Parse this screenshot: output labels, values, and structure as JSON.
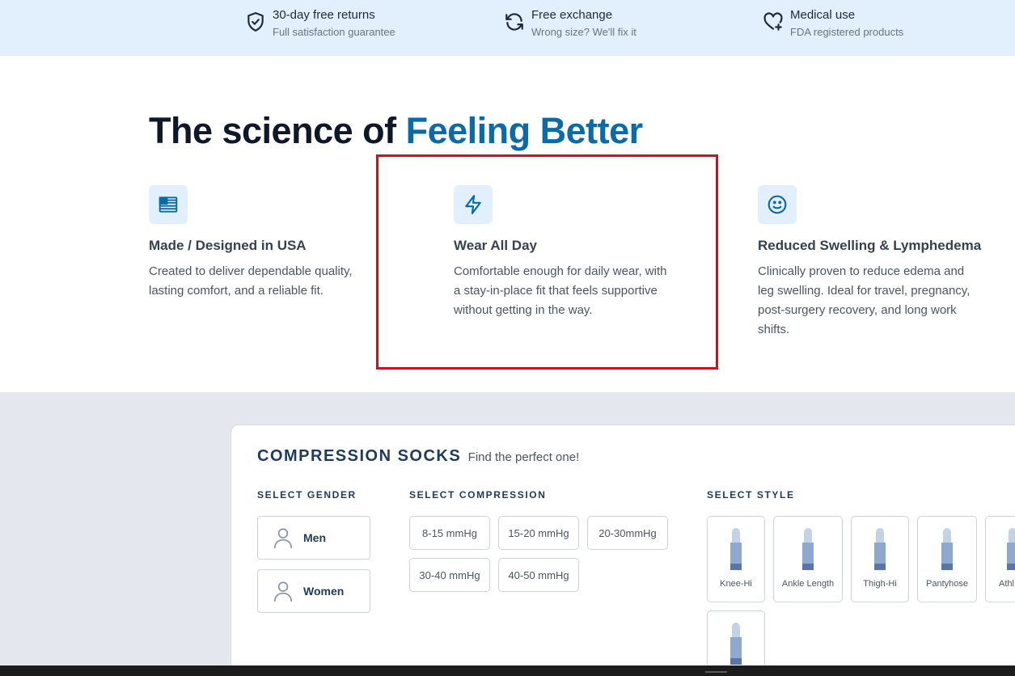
{
  "topbar": {
    "items": [
      {
        "title": "30-day free returns",
        "subtitle": "Full satisfaction guarantee",
        "icon": "shield-check-icon"
      },
      {
        "title": "Free exchange",
        "subtitle": "Wrong size? We'll fix it",
        "icon": "refresh-icon"
      },
      {
        "title": "Medical use",
        "subtitle": "FDA registered products",
        "icon": "heart-plus-icon"
      }
    ]
  },
  "hero": {
    "title_prefix": "The science of",
    "title_accent": "Feeling Better"
  },
  "features": [
    {
      "icon": "flag-icon",
      "title": "Made / Designed in USA",
      "description": "Created to deliver dependable quality, lasting comfort, and a reliable fit."
    },
    {
      "icon": "lightning-icon",
      "title": "Wear All Day",
      "description": "Comfortable enough for daily wear, with a stay-in-place fit that feels supportive without getting in the way."
    },
    {
      "icon": "smile-icon",
      "title": "Reduced Swelling & Lymphedema",
      "description": "Clinically proven to reduce edema and leg swelling. Ideal for travel, pregnancy, post-surgery recovery, and long work shifts."
    }
  ],
  "finder": {
    "title": "COMPRESSION SOCKS",
    "subtitle": "Find the perfect one!",
    "gender_label": "SELECT GENDER",
    "genders": [
      "Men",
      "Women"
    ],
    "compression_label": "SELECT COMPRESSION",
    "compressions": [
      "8-15 mmHg",
      "15-20 mmHg",
      "20-30mmHg",
      "30-40 mmHg",
      "40-50 mmHg"
    ],
    "style_label": "SELECT STYLE",
    "styles": [
      "Knee-Hi",
      "Ankle Length",
      "Thigh-Hi",
      "Pantyhose",
      "Athl"
    ]
  },
  "colors": {
    "accent": "#0b6aa8",
    "topbar_bg": "#e1f0fc",
    "highlight": "#d0111b",
    "navy": "#1e3a5f"
  }
}
